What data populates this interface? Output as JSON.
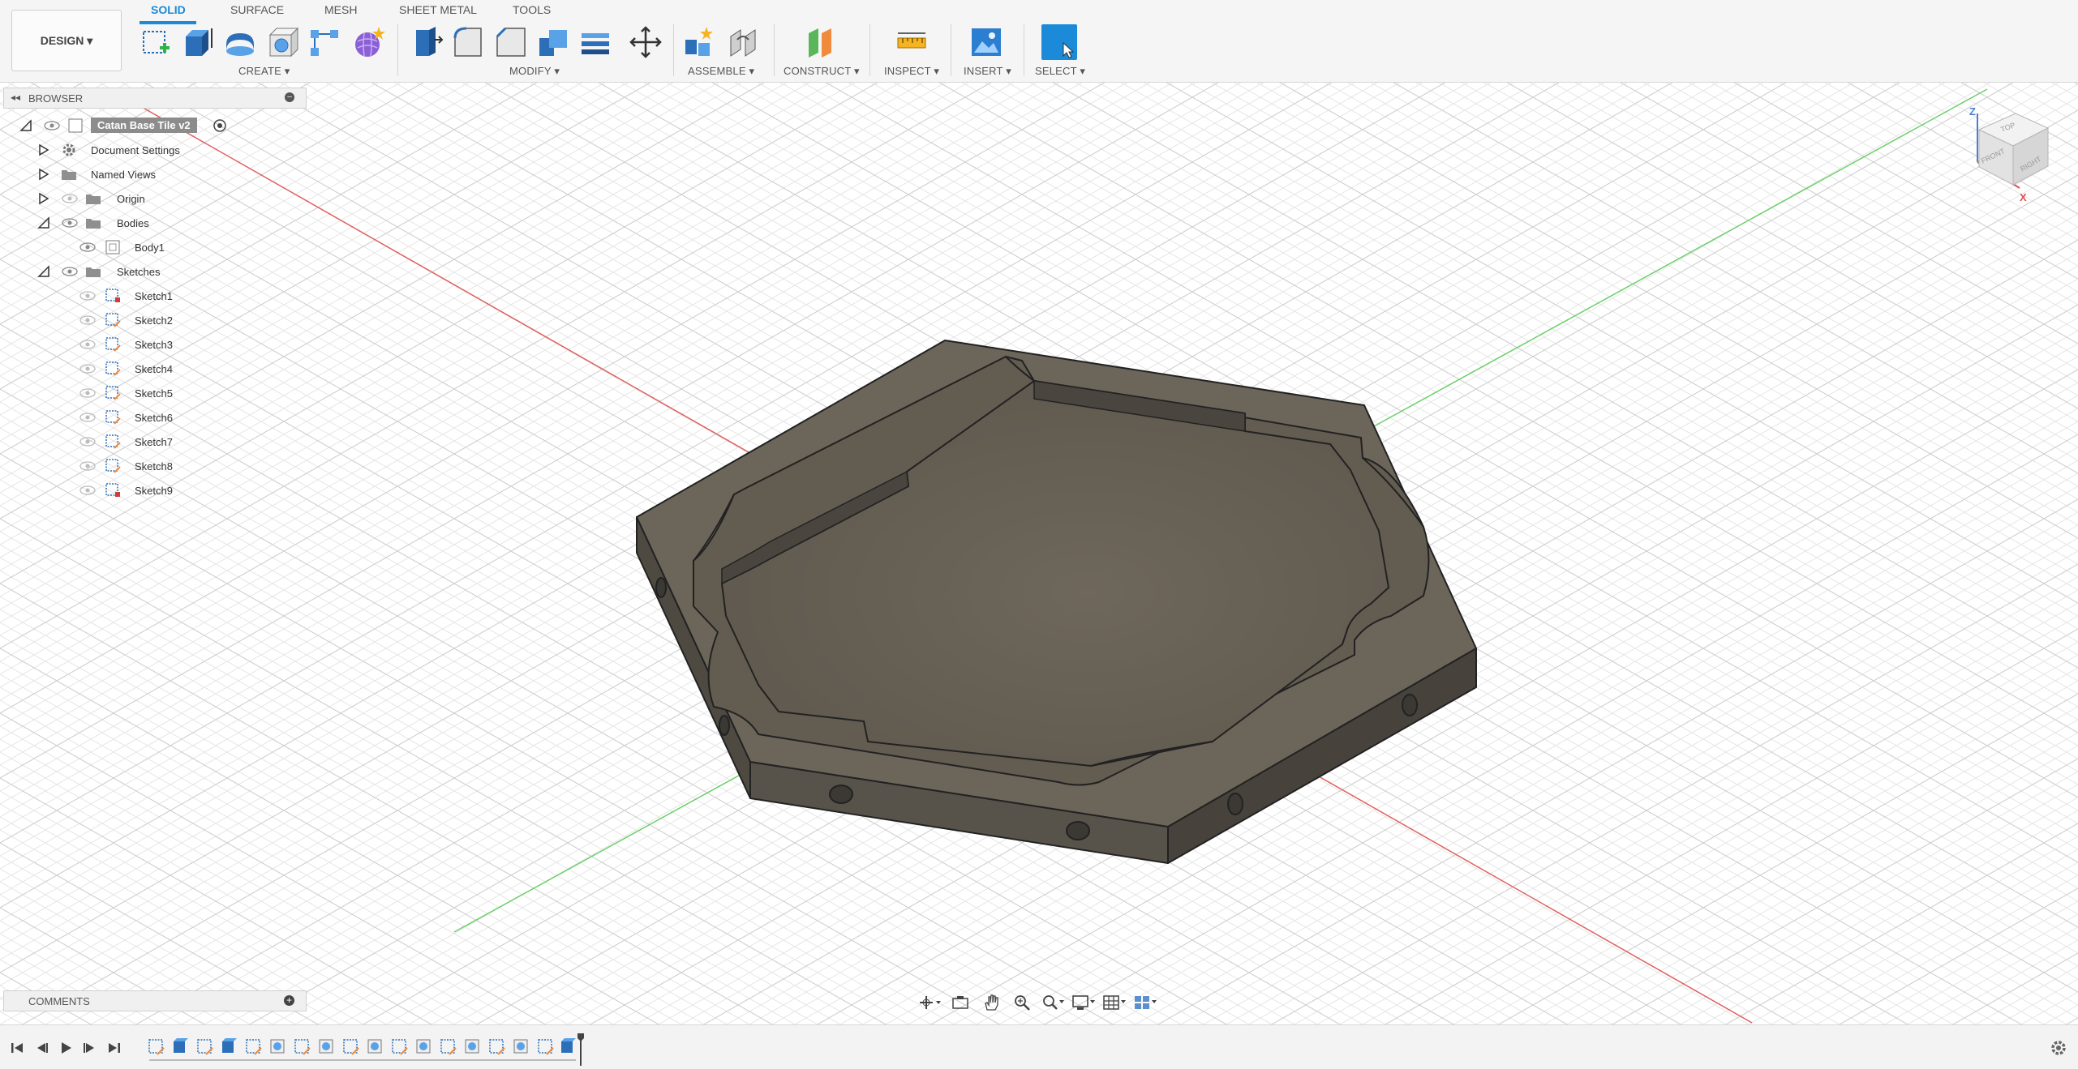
{
  "toolbar": {
    "design_label": "DESIGN ▾",
    "tabs": [
      "SOLID",
      "SURFACE",
      "MESH",
      "SHEET METAL",
      "TOOLS"
    ],
    "groups": [
      "CREATE ▾",
      "MODIFY ▾",
      "ASSEMBLE ▾",
      "CONSTRUCT ▾",
      "INSPECT ▾",
      "INSERT ▾",
      "SELECT ▾"
    ]
  },
  "browser": {
    "title": "BROWSER",
    "root": "Catan Base Tile v2",
    "items": [
      "Document Settings",
      "Named Views",
      "Origin",
      "Bodies",
      "Body1",
      "Sketches"
    ],
    "sketches": [
      "Sketch1",
      "Sketch2",
      "Sketch3",
      "Sketch4",
      "Sketch5",
      "Sketch6",
      "Sketch7",
      "Sketch8",
      "Sketch9"
    ]
  },
  "comments": {
    "title": "COMMENTS"
  },
  "viewcube": {
    "faces": [
      "TOP",
      "FRONT",
      "RIGHT"
    ],
    "axes": [
      "Z",
      "X"
    ]
  },
  "colors": {
    "accent": "#1b8ad8",
    "model_top": "#6c6559",
    "model_side": "#4e4a42",
    "axis_x": "#e06060",
    "axis_y": "#6ccf6c"
  }
}
